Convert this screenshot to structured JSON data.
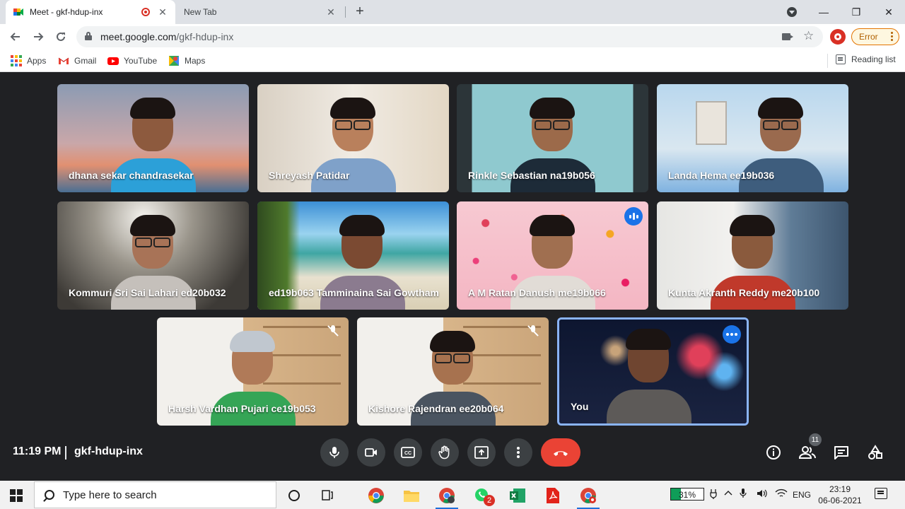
{
  "browser": {
    "tabs": [
      {
        "title": "Meet - gkf-hdup-inx",
        "close": "✕"
      },
      {
        "title": "New Tab",
        "close": "✕"
      }
    ],
    "new_tab": "+",
    "window_controls": {
      "minimize": "—",
      "restore": "❐",
      "close": "✕"
    },
    "url_host": "meet.google.com",
    "url_path": "/gkf-hdup-inx",
    "error_label": "Error",
    "bookmarks": [
      "Apps",
      "Gmail",
      "YouTube",
      "Maps"
    ],
    "reading_list": "Reading list"
  },
  "meeting": {
    "time": "11:19 PM",
    "code": "gkf-hdup-inx",
    "participant_count": "11",
    "participants": [
      {
        "name": "dhana sekar chandrasekar"
      },
      {
        "name": "Shreyash Patidar"
      },
      {
        "name": "Rinkle Sebastian na19b056"
      },
      {
        "name": "Landa Hema ee19b036"
      },
      {
        "name": "Kommuri Sri Sai Lahari ed20b032"
      },
      {
        "name": "ed19b063 Tamminaina Sai Gowtham"
      },
      {
        "name": "A M Ratan Danush me19b066"
      },
      {
        "name": "Kunta Akranth Reddy me20b100"
      },
      {
        "name": "Harsh Vardhan Pujari ce19b053"
      },
      {
        "name": "Kishore Rajendran ee20b064"
      },
      {
        "name": "You"
      }
    ]
  },
  "taskbar": {
    "search_placeholder": "Type here to search",
    "battery": "31%",
    "language": "ENG",
    "time": "23:19",
    "date": "06-06-2021",
    "whatsapp_badge": "2"
  },
  "colors": {
    "meet_bg": "#202124",
    "hangup": "#ea4335",
    "active_speaker": "#1a73e8",
    "self_border": "#8ab4f8"
  }
}
